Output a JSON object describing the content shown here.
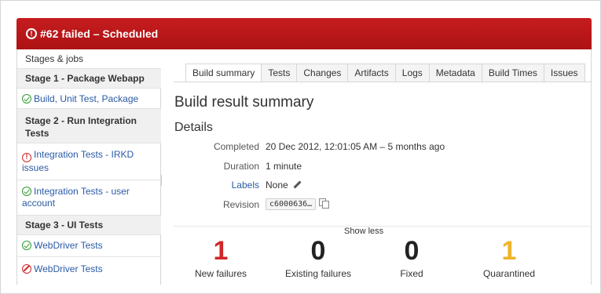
{
  "header": {
    "title": "#62 failed – Scheduled",
    "icon": "error-circle-icon",
    "color": "#c1191b"
  },
  "sidebar": {
    "heading": "Stages & jobs",
    "stage1": "Stage 1 - Package Webapp",
    "job_build": "Build, Unit Test, Package",
    "stage2": "Stage 2 - Run Integration Tests",
    "job_irkd": "Integration Tests - IRKD issues",
    "job_user": "Integration Tests - user account",
    "stage3": "Stage 3 - UI Tests",
    "job_wd_ok": "WebDriver Tests",
    "job_wd_stop": "WebDriver Tests"
  },
  "tabs": [
    "Build summary",
    "Tests",
    "Changes",
    "Artifacts",
    "Logs",
    "Metadata",
    "Build Times",
    "Issues"
  ],
  "main": {
    "title": "Build result summary",
    "details_heading": "Details",
    "completed_label": "Completed",
    "completed_value": "20 Dec 2012, 12:01:05 AM – 5 months ago",
    "duration_label": "Duration",
    "duration_value": "1 minute",
    "labels_label": "Labels",
    "labels_value": "None",
    "revision_label": "Revision",
    "revision_value": "c6000636…",
    "show_less": "Show less"
  },
  "stats": {
    "new_failures": {
      "value": "1",
      "label": "New failures",
      "color": "#d0282a"
    },
    "existing_failures": {
      "value": "0",
      "label": "Existing failures",
      "color": "#222222"
    },
    "fixed": {
      "value": "0",
      "label": "Fixed",
      "color": "#222222"
    },
    "quarantined": {
      "value": "1",
      "label": "Quarantined",
      "color": "#f0b429"
    }
  }
}
